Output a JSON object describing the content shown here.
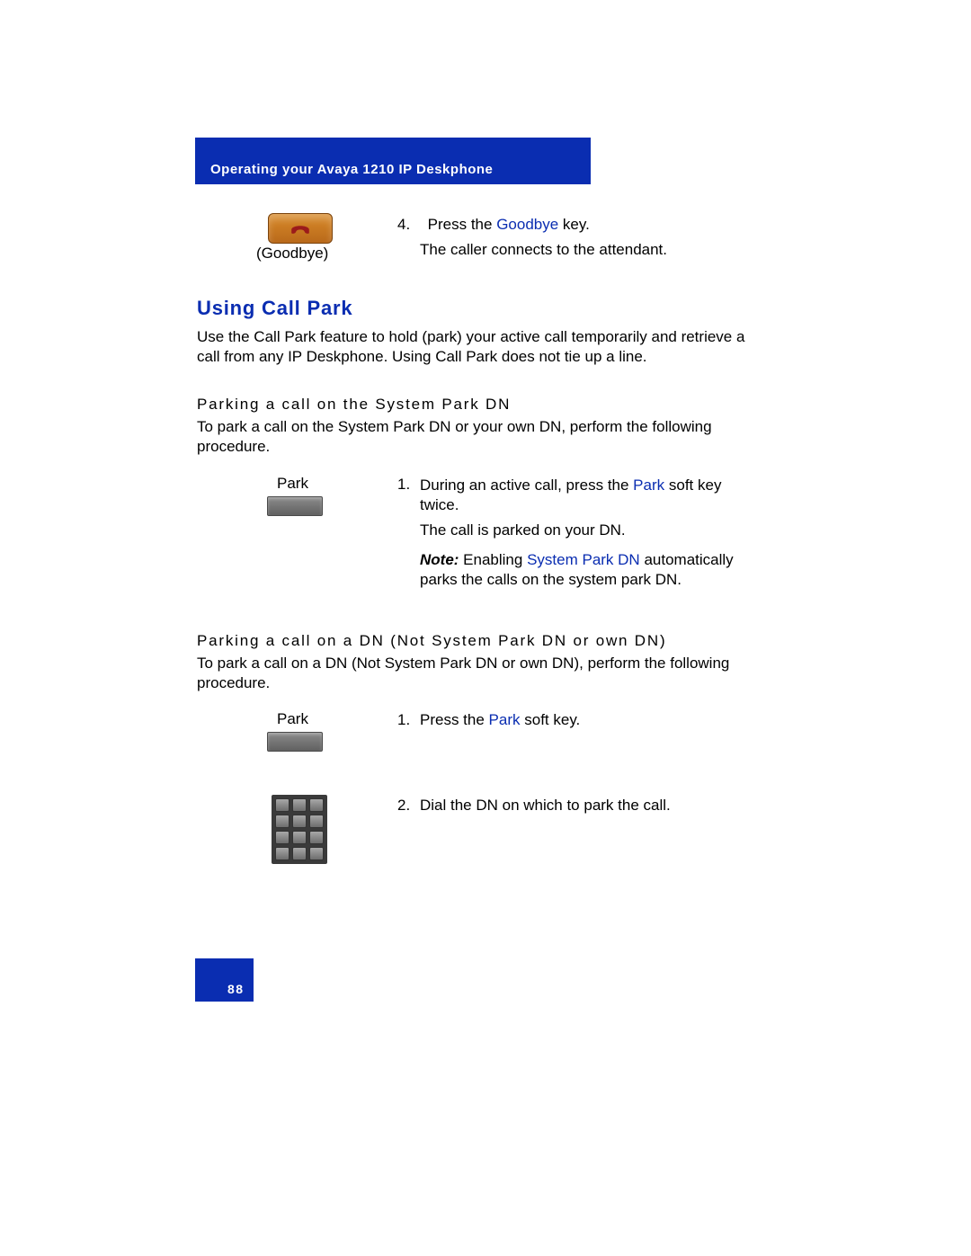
{
  "header": {
    "title": "Operating your Avaya 1210 IP Deskphone"
  },
  "goodbye": {
    "caption": "(Goodbye)",
    "step_num": "4.",
    "step_pre": "Press the ",
    "step_link": "Goodbye",
    "step_post": "  key.",
    "sub": "The caller connects to the attendant."
  },
  "section": {
    "heading": "Using Call Park",
    "intro": "Use the Call Park feature to hold (park) your active call temporarily and retrieve a call from any IP Deskphone. Using Call Park does not tie up a line."
  },
  "sub1": {
    "heading": "Parking a call on the System Park DN",
    "para": "To park a call on the System Park DN or your own DN, perform the following procedure.",
    "key_label": "Park",
    "step_num": "1.",
    "step_pre": "During an active call, press the ",
    "step_link": "Park",
    "step_post": "  soft key twice.",
    "step_sub": "The call is parked on your DN.",
    "note_lead": "Note:",
    "note_pre": "  Enabling ",
    "note_link": "System Park DN",
    "note_post": " automatically parks the calls on the system park DN."
  },
  "sub2": {
    "heading": "Parking a call on a DN (Not System Park DN or own DN)",
    "para": "To park a call on a DN (Not System Park DN or own DN), perform the following procedure.",
    "key_label": "Park",
    "step1_num": "1.",
    "step1_pre": "Press the ",
    "step1_link": "Park",
    "step1_post": "  soft key.",
    "step2_num": "2.",
    "step2_text": "Dial the DN on which to park the call."
  },
  "footer": {
    "page": "88"
  }
}
